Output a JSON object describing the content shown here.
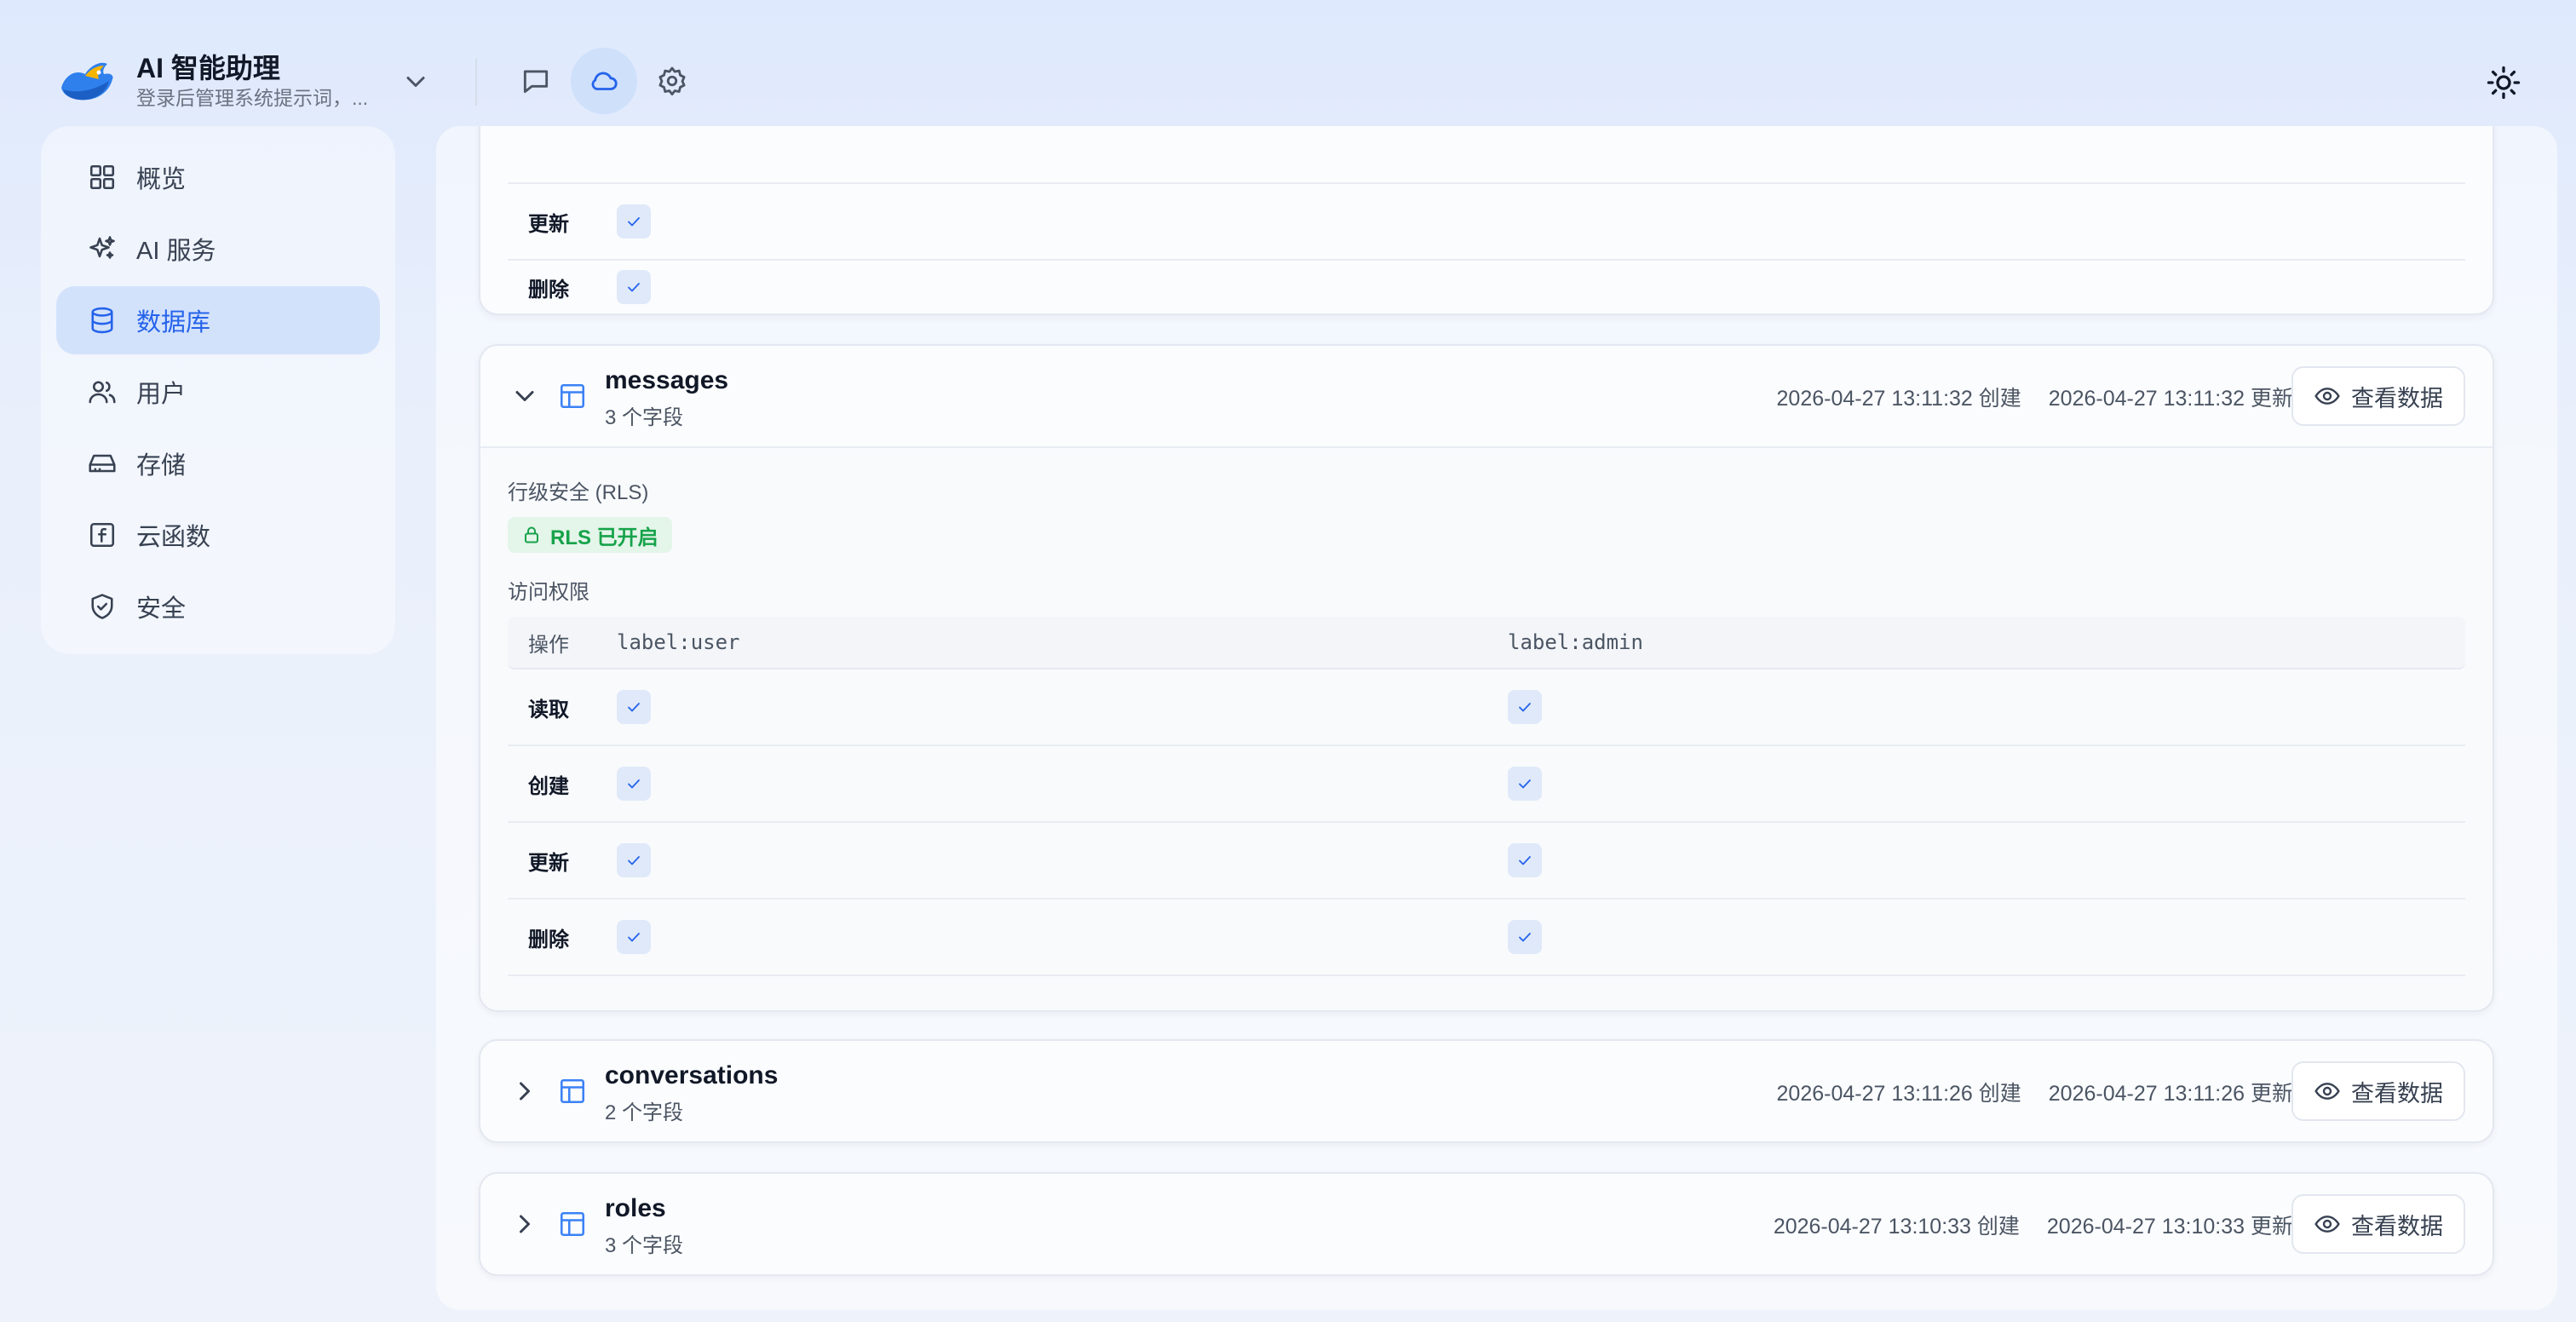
{
  "app": {
    "title": "AI 智能助理",
    "subtitle": "登录后管理系统提示词，..."
  },
  "header_icons": [
    "chat-icon",
    "cloud-icon",
    "gear-icon",
    "sun-icon"
  ],
  "colors": {
    "accent": "#2563eb",
    "active_nav_bg": "#d3e2fb",
    "rls_green": "#16a34a",
    "check_bg": "#dfe9f9"
  },
  "sidebar": {
    "items": [
      {
        "label": "概览",
        "icon": "grid-icon"
      },
      {
        "label": "AI 服务",
        "icon": "sparkle-icon"
      },
      {
        "label": "数据库",
        "icon": "database-icon",
        "active": true
      },
      {
        "label": "用户",
        "icon": "users-icon"
      },
      {
        "label": "存储",
        "icon": "hard-drive-icon"
      },
      {
        "label": "云函数",
        "icon": "function-icon"
      },
      {
        "label": "安全",
        "icon": "shield-icon"
      }
    ]
  },
  "partial_card": {
    "rows": [
      {
        "op": "更新",
        "user": true
      },
      {
        "op": "删除",
        "user": true
      }
    ]
  },
  "tables": [
    {
      "name": "messages",
      "fields": "3 个字段",
      "created": "2026-04-27 13:11:32 创建",
      "updated": "2026-04-27 13:11:32 更新",
      "view_label": "查看数据",
      "expanded": true
    },
    {
      "name": "conversations",
      "fields": "2 个字段",
      "created": "2026-04-27 13:11:26 创建",
      "updated": "2026-04-27 13:11:26 更新",
      "view_label": "查看数据",
      "expanded": false
    },
    {
      "name": "roles",
      "fields": "3 个字段",
      "created": "2026-04-27 13:10:33 创建",
      "updated": "2026-04-27 13:10:33 更新",
      "view_label": "查看数据",
      "expanded": false
    }
  ],
  "messages_detail": {
    "rls_label": "行级安全 (RLS)",
    "rls_badge": "RLS 已开启",
    "access_label": "访问权限",
    "columns": {
      "op": "操作",
      "user": "label:user",
      "admin": "label:admin"
    },
    "rows": [
      {
        "op": "读取",
        "user": true,
        "admin": true
      },
      {
        "op": "创建",
        "user": true,
        "admin": true
      },
      {
        "op": "更新",
        "user": true,
        "admin": true
      },
      {
        "op": "删除",
        "user": true,
        "admin": true
      }
    ]
  }
}
